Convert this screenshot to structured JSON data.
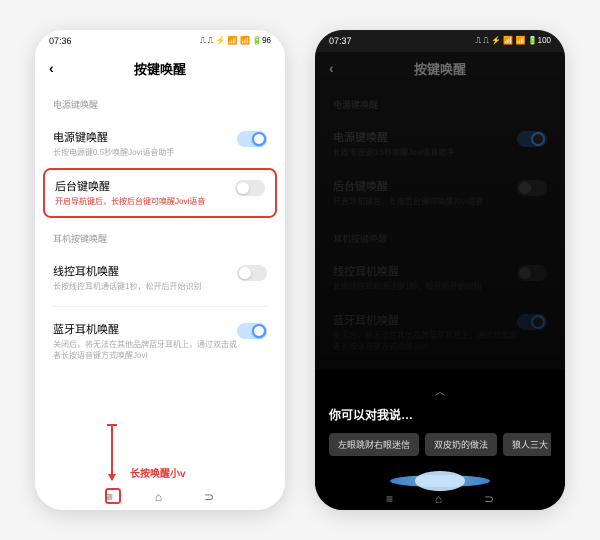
{
  "left": {
    "time": "07:36",
    "status_icons": "⎍ ⎍ ⚡ 📶 📶 🔋96",
    "title": "按键唤醒",
    "section1": "电源键唤醒",
    "item1": {
      "title": "电源键唤醒",
      "desc": "长按电源键0.5秒唤醒Jovi语音助手"
    },
    "item2": {
      "title": "后台键唤醒",
      "desc": "开启导航键后，长按后台键可唤醒Jovi语音"
    },
    "section2": "耳机按键唤醒",
    "item3": {
      "title": "线控耳机唤醒",
      "desc": "长按线控耳机通话键1秒，松开后开始识别"
    },
    "item4": {
      "title": "蓝牙耳机唤醒",
      "desc": "关闭后，将无法在其他品牌蓝牙耳机上，通过双击或者长按语音键方式唤醒Jovi"
    },
    "annotation": "长按唤醒小v"
  },
  "right": {
    "time": "07:37",
    "status_icons": "⎍ ⎍ ⚡ 📶 📶 🔋100",
    "title": "按键唤醒",
    "section1": "电源键唤醒",
    "item1": {
      "title": "电源键唤醒",
      "desc": "长按电源键0.5秒唤醒Jovi语音助手"
    },
    "item2": {
      "title": "后台键唤醒",
      "desc": "开启导航键后，长按后台键可唤醒Jovi语音"
    },
    "section2": "耳机按键唤醒",
    "item3": {
      "title": "线控耳机唤醒",
      "desc": "长按线控耳机通话键1秒，松开后开始识别"
    },
    "item4": {
      "title": "蓝牙耳机唤醒",
      "desc": "关闭后，将无法在其他品牌蓝牙耳机上，通过双击或者长按语音键方式唤醒Jovi"
    },
    "prompt": "你可以对我说…",
    "chips": [
      "左眼跳财右眼迷信",
      "双皮奶的做法",
      "狼人三大"
    ]
  }
}
